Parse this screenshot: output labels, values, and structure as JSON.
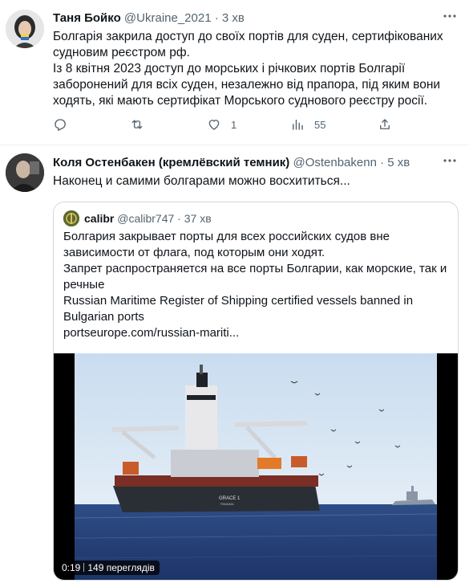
{
  "tweets": [
    {
      "author": "Таня Бойко",
      "handle": "@Ukraine_2021",
      "dot": "·",
      "time": "3 хв",
      "text": [
        "Болгарія закрила доступ до своїх портів для суден, сертифікованих судновим реєстром рф.",
        "Із 8 квітня 2023 доступ до морських і річкових портів Болгарії заборонений для всіх суден, незалежно від прапора, під яким вони ходять, які мають сертифікат Морського суднового реєстру росії."
      ],
      "likes": "1",
      "views": "55"
    },
    {
      "author": "Коля Остенбакен (кремлёвский темник)",
      "handle": "@Ostenbakenn",
      "dot": "·",
      "time": "5 хв",
      "text": "Наконец и самими болгарами можно восхититься...",
      "quote": {
        "author": "calibr",
        "handle": "@calibr747",
        "dot": "·",
        "time": "37 хв",
        "text": [
          "Болгария закрывает порты для всех российских судов вне зависимости от флага, под которым они ходят.",
          "Запрет распространяется на все порты Болгарии, как морские, так и речные",
          "Russian Maritime Register of Shipping certified vessels banned in Bulgarian ports",
          "portseurope.com/russian-mariti..."
        ],
        "video": {
          "duration": "0:19",
          "views": "149 переглядів",
          "ship_name": "GRACE 1",
          "ship_port": "PANAMA"
        }
      }
    }
  ],
  "icons": {
    "more": "more-icon",
    "reply": "reply-icon",
    "retweet": "retweet-icon",
    "like": "like-icon",
    "views": "views-icon",
    "share": "share-icon"
  },
  "colors": {
    "text": "#0f1419",
    "secondary": "#536471",
    "border": "#cfd9de"
  }
}
